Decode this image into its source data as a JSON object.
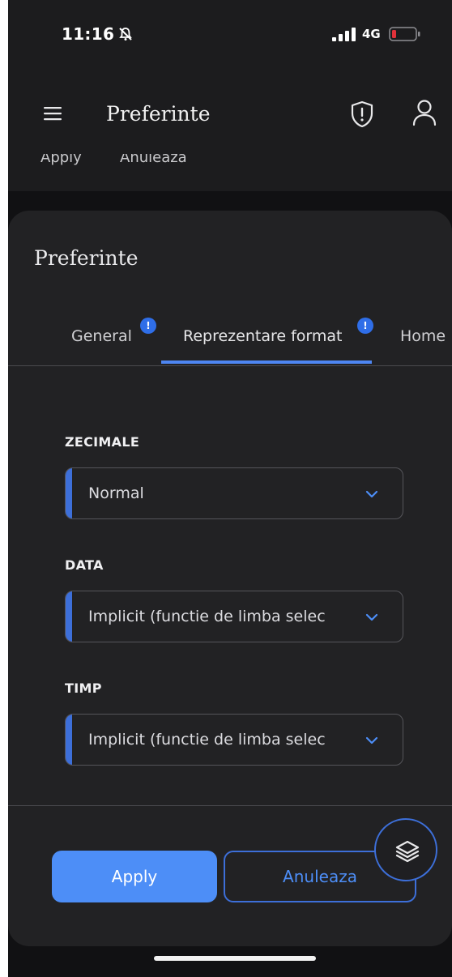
{
  "status_bar": {
    "time": "11:16",
    "network": "4G"
  },
  "header": {
    "title": "Preferinte"
  },
  "peek_bar": {
    "apply": "Apply",
    "cancel": "Anuleaza"
  },
  "sheet": {
    "title": "Preferinte",
    "tabs": [
      {
        "label": "General",
        "badge": "!"
      },
      {
        "label": "Reprezentare format",
        "badge": "!",
        "active": true
      },
      {
        "label": "Home"
      }
    ],
    "fields": [
      {
        "label": "ZECIMALE",
        "value": "Normal"
      },
      {
        "label": "DATA",
        "value": "Implicit (functie de limba selec"
      },
      {
        "label": "TIMP",
        "value": "Implicit (functie de limba selec"
      }
    ],
    "apply_label": "Apply",
    "cancel_label": "Anuleaza"
  },
  "colors": {
    "accent": "#4d8ef7",
    "accent_dark": "#3d6fd9",
    "badge": "#2f6ee8",
    "battery_low": "#e0313a"
  },
  "icons": [
    "bell-off-icon",
    "signal-icon",
    "battery-icon",
    "hamburger-icon",
    "shield-icon",
    "user-icon",
    "chevron-down-icon",
    "layers-icon"
  ]
}
